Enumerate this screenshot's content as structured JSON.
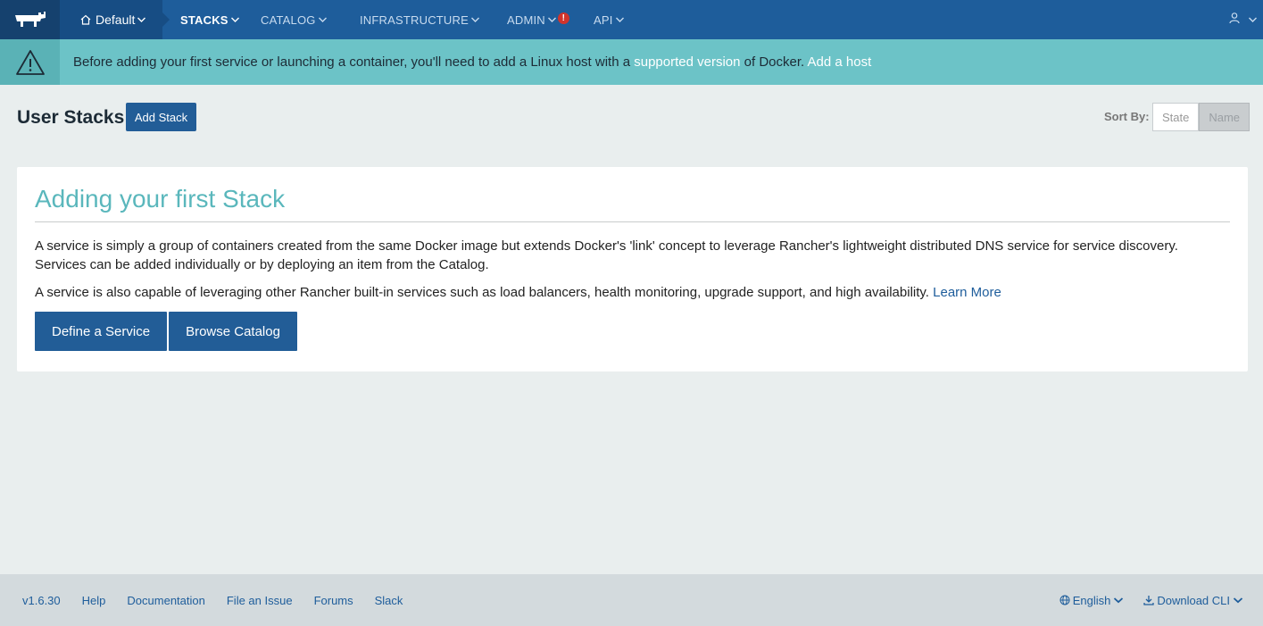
{
  "nav": {
    "environment": "Default",
    "items": [
      "STACKS",
      "CATALOG",
      "INFRASTRUCTURE",
      "ADMIN",
      "API"
    ],
    "admin_alert": "!"
  },
  "banner": {
    "text_before": "Before adding your first service or launching a container, you'll need to add a Linux host with a ",
    "link_supported": "supported version",
    "text_middle": " of Docker. ",
    "link_add_host": "Add a host"
  },
  "header": {
    "title": "User Stacks",
    "add_stack": "Add Stack",
    "sort_label": "Sort By:",
    "sort_options": [
      "State",
      "Name"
    ],
    "sort_selected": "Name"
  },
  "card": {
    "title": "Adding your first Stack",
    "p1": "A service is simply a group of containers created from the same Docker image but extends Docker's 'link' concept to leverage Rancher's lightweight distributed DNS service for service discovery. Services can be added individually or by deploying an item from the Catalog.",
    "p2": "A service is also capable of leveraging other Rancher built-in services such as load balancers, health monitoring, upgrade support, and high availability. ",
    "learn_more": "Learn More",
    "define_service": "Define a Service",
    "browse_catalog": "Browse Catalog"
  },
  "footer": {
    "version": "v1.6.30",
    "links": [
      "Help",
      "Documentation",
      "File an Issue",
      "Forums",
      "Slack"
    ],
    "language": "English",
    "download_cli": "Download CLI"
  },
  "colors": {
    "nav_bg": "#1e5d9b",
    "banner_bg": "#6cc3c7",
    "accent_title": "#5ab7bc",
    "primary_button": "#225d97"
  },
  "icons": [
    "rancher-logo",
    "home-icon",
    "chevron-down-icon",
    "warning-icon",
    "user-icon",
    "globe-icon",
    "download-icon"
  ]
}
